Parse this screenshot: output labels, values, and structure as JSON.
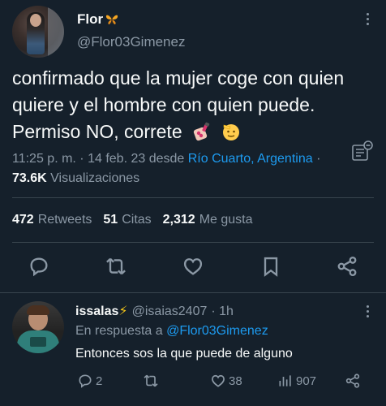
{
  "main_tweet": {
    "author_name": "Flor",
    "author_badge_icon": "butterfly-icon",
    "author_handle": "@Flor03Gimenez",
    "text": "confirmado que la mujer coge con quien quiere y el hombre con quien puede. Permiso NO, correte",
    "emojis": [
      "nail-polish-emoji",
      "saluting-face-emoji"
    ],
    "time_date": "11:25 p. m. · 14 feb. 23 desde",
    "location": "Río Cuarto, Argentina",
    "views_sep": " · ",
    "views_count": "73.6K",
    "views_label": "Visualizaciones",
    "stats": [
      {
        "count": "472",
        "label": "Retweets"
      },
      {
        "count": "51",
        "label": "Citas"
      },
      {
        "count": "2,312",
        "label": "Me gusta"
      }
    ]
  },
  "reply": {
    "author_name": "issalas",
    "author_badge": "⚡",
    "author_handle": "@isaias2407",
    "time": "· 1h",
    "replying_prefix": "En respuesta a",
    "replying_to": "@Flor03Gimenez",
    "text": "Entonces sos la que puede de alguno",
    "replies_count": "2",
    "likes_count": "38",
    "views_count": "907"
  },
  "colors": {
    "background": "#15202b",
    "text": "#f7f9f9",
    "muted": "#8b98a5",
    "link": "#1d9bf0",
    "divider": "#38444d"
  }
}
